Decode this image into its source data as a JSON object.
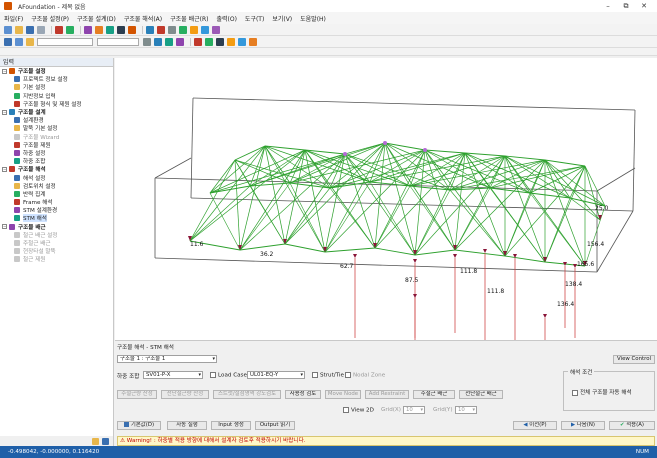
{
  "window": {
    "title": "AFoundation - 제목 없음"
  },
  "menu": [
    "파일(F)",
    "구조물 설정(P)",
    "구조물 설계(D)",
    "구조물 해석(A)",
    "구조물 배근(R)",
    "출력(O)",
    "도구(T)",
    "보기(V)",
    "도움말(H)"
  ],
  "panel": {
    "title": "입력",
    "groups": [
      {
        "label": "구조물 설정",
        "items": [
          {
            "label": "프로젝트 정보 설정",
            "state": "normal"
          },
          {
            "label": "기본 설정",
            "state": "normal"
          },
          {
            "label": "지반정보 입력",
            "state": "normal"
          },
          {
            "label": "구조물 형식 및 제원 설정",
            "state": "normal"
          }
        ]
      },
      {
        "label": "구조물 설계",
        "items": [
          {
            "label": "설계환경",
            "state": "normal"
          },
          {
            "label": "말뚝 기본 설정",
            "state": "normal"
          },
          {
            "label": "구조물 Wizard",
            "state": "disabled"
          },
          {
            "label": "구조물 제원",
            "state": "normal"
          },
          {
            "label": "하중 설정",
            "state": "normal"
          },
          {
            "label": "하중 조합",
            "state": "normal"
          }
        ]
      },
      {
        "label": "구조물 해석",
        "items": [
          {
            "label": "해석 설정",
            "state": "normal"
          },
          {
            "label": "검토위치 설정",
            "state": "normal"
          },
          {
            "label": "반력 집계",
            "state": "normal"
          },
          {
            "label": "Frame 해석",
            "state": "normal"
          },
          {
            "label": "STM 설계환경",
            "state": "normal"
          },
          {
            "label": "STM 해석",
            "state": "selected"
          }
        ]
      },
      {
        "label": "구조물 배근",
        "items": [
          {
            "label": "철근 배근 설정",
            "state": "disabled"
          },
          {
            "label": "주철근 배근",
            "state": "disabled"
          },
          {
            "label": "현장타설 말뚝",
            "state": "disabled"
          },
          {
            "label": "철근 제원",
            "state": "disabled"
          }
        ]
      }
    ]
  },
  "view": {
    "labels": [
      "25.0",
      "156.4",
      "165.6",
      "138.4",
      "62.7",
      "87.5",
      "111.8",
      "111.8",
      "136.4",
      "36.2",
      "11.6"
    ]
  },
  "analysis": {
    "title": "구조물 해석 - STM 해석",
    "structure_select": "구조물 1 : 구조물 1",
    "view_control": "View Control",
    "load_combo_label": "하중 조합",
    "load_combo_value": "SV01-P-X",
    "load_case_label": "Load Case",
    "load_case_value": "UL01-EQ-Y",
    "strut_tie": "Strut/Tie",
    "nodal_zone": "Nodal Zone",
    "buttons": [
      "주철근량 산정",
      "전단철근량 산정",
      "스트럿/절점영역 강도검토",
      "사용성 검토",
      "Move Node",
      "Add Restraint",
      "주철근 배근",
      "전단철근 배근"
    ],
    "view_2d": "View 2D",
    "grid_x_label": "Grid(X)",
    "grid_x_value": "10",
    "grid_y_label": "Grid(Y)",
    "grid_y_value": "10",
    "conditions_title": "해석 조건",
    "apply_all": "전체 구조물 자동 해석",
    "bottom_buttons": [
      "기본값(D)",
      "자동 실행",
      "Input 생성",
      "Output 읽기"
    ],
    "prev": "이전(P)",
    "next": "다음(N)",
    "apply": "적용(A)",
    "warning": "Warning! : 하중별 적용 방향에 대해서 설계자 검토후 적용하시기 바랍니다."
  },
  "status": {
    "coords": "-0.498042, -0.000000, 0.116420",
    "mode": "NUM"
  }
}
